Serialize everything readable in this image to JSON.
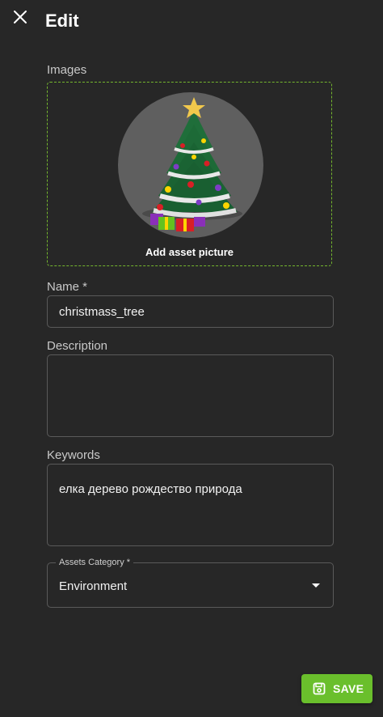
{
  "header": {
    "title": "Edit",
    "close_icon": "close-icon"
  },
  "images": {
    "label": "Images",
    "add_picture_label": "Add asset picture",
    "accent_color": "#74b62e"
  },
  "name": {
    "label": "Name *",
    "value": "christmass_tree"
  },
  "description": {
    "label": "Description",
    "value": ""
  },
  "keywords": {
    "label": "Keywords",
    "value": "елка дерево рождество природа"
  },
  "category": {
    "label": "Assets Category *",
    "value": "Environment",
    "icon": "chevron-down-icon"
  },
  "actions": {
    "save_label": "SAVE",
    "save_icon": "save-icon",
    "save_color": "#6abf2c"
  }
}
